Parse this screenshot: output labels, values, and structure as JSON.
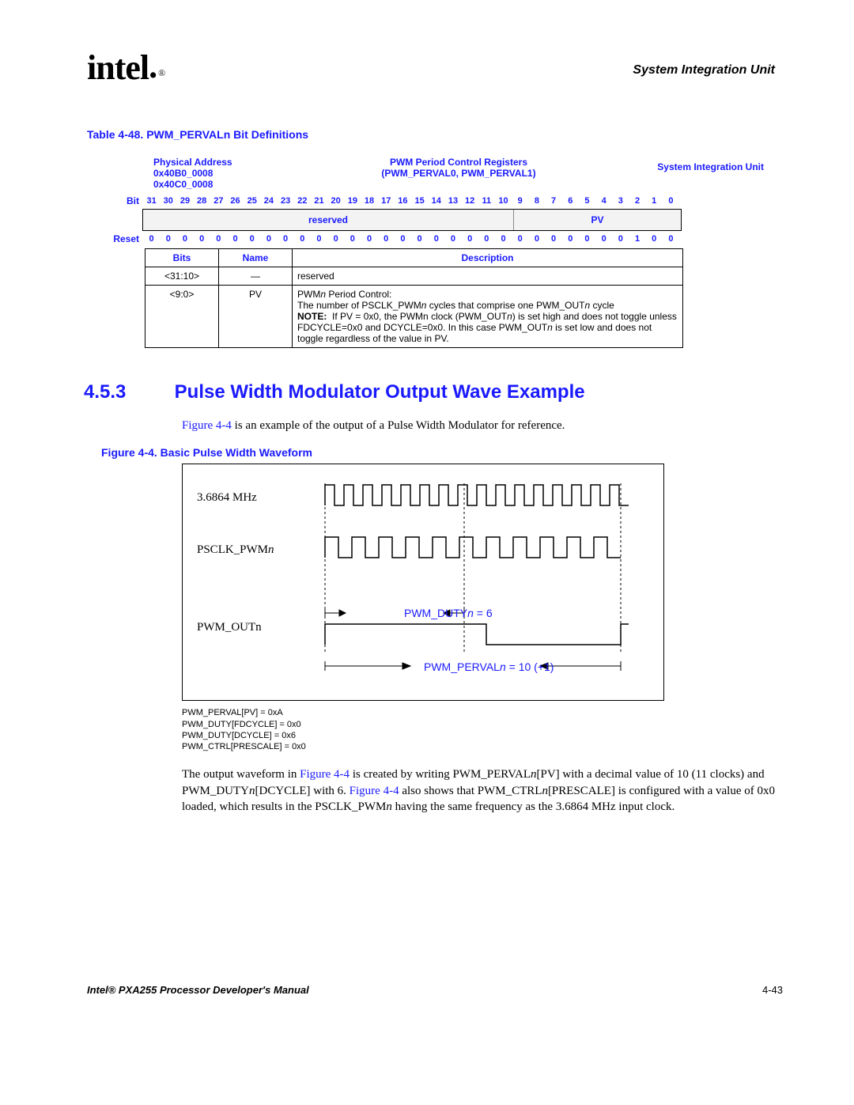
{
  "header": {
    "chapter": "System Integration Unit",
    "logo": "intel"
  },
  "table48": {
    "title": "Table 4-48. PWM_PERVALn Bit Definitions",
    "phys_addr_label": "Physical Address",
    "phys_addr_1": "0x40B0_0008",
    "phys_addr_2": "0x40C0_0008",
    "reg_name_1": "PWM Period Control Registers",
    "reg_name_2": "(PWM_PERVAL0, PWM_PERVAL1)",
    "unit": "System Integration Unit",
    "bit_label": "Bit",
    "reset_label": "Reset",
    "field_reserved": "reserved",
    "field_pv": "PV",
    "bits": [
      "31",
      "30",
      "29",
      "28",
      "27",
      "26",
      "25",
      "24",
      "23",
      "22",
      "21",
      "20",
      "19",
      "18",
      "17",
      "16",
      "15",
      "14",
      "13",
      "12",
      "11",
      "10",
      "9",
      "8",
      "7",
      "6",
      "5",
      "4",
      "3",
      "2",
      "1",
      "0"
    ],
    "reset_vals": [
      "0",
      "0",
      "0",
      "0",
      "0",
      "0",
      "0",
      "0",
      "0",
      "0",
      "0",
      "0",
      "0",
      "0",
      "0",
      "0",
      "0",
      "0",
      "0",
      "0",
      "0",
      "0",
      "0",
      "0",
      "0",
      "0",
      "0",
      "0",
      "0",
      "1",
      "0",
      "0"
    ],
    "col_bits": "Bits",
    "col_name": "Name",
    "col_desc": "Description",
    "rows": [
      {
        "bits": "<31:10>",
        "name": "—",
        "desc": "reserved"
      },
      {
        "bits": "<9:0>",
        "name": "PV",
        "desc": "PWMn Period Control:\nThe number of PSCLK_PWMn cycles that comprise one PWM_OUTn cycle\nNOTE: If PV = 0x0, the PWMn clock (PWM_OUTn) is set high and does not toggle unless FDCYCLE=0x0 and DCYCLE=0x0. In this case PWM_OUTn is set low and does not toggle regardless of the value in PV."
      }
    ]
  },
  "section": {
    "num": "4.5.3",
    "title": "Pulse Width Modulator Output Wave Example",
    "intro_a": "Figure 4-4",
    "intro_b": " is an example of the output of a Pulse Width Modulator for reference."
  },
  "figure": {
    "caption": "Figure 4-4. Basic Pulse Width Waveform",
    "row1": "3.6864 MHz",
    "row2_a": "PSCLK_PWM",
    "row2_n": "n",
    "row3": "PWM_OUTn",
    "ann1_a": "PWM_DUTY",
    "ann1_n": "n",
    "ann1_b": " = 6",
    "ann2_a": "PWM_PERVAL",
    "ann2_n": "n",
    "ann2_b": " = 10 (+1)",
    "notes": [
      "PWM_PERVAL[PV] = 0xA",
      "PWM_DUTY[FDCYCLE] = 0x0",
      "PWM_DUTY[DCYCLE] = 0x6",
      "PWM_CTRL[PRESCALE] = 0x0"
    ]
  },
  "para2": {
    "a": "The output waveform in ",
    "link1": "Figure 4-4",
    "b": " is created by writing PWM_PERVAL",
    "n1": "n",
    "c": "[PV] with a decimal value of 10 (11 clocks) and PWM_DUTY",
    "n2": "n",
    "d": "[DCYCLE] with 6. ",
    "link2": "Figure 4-4",
    "e": " also shows that PWM_CTRL",
    "n3": "n",
    "f": "[PRESCALE] is configured with a value of 0x0 loaded, which results in the PSCLK_PWM",
    "n4": "n",
    "g": " having the same frequency as the 3.6864 MHz input clock."
  },
  "footer": {
    "left": "Intel® PXA255 Processor Developer's Manual",
    "right": "4-43"
  }
}
